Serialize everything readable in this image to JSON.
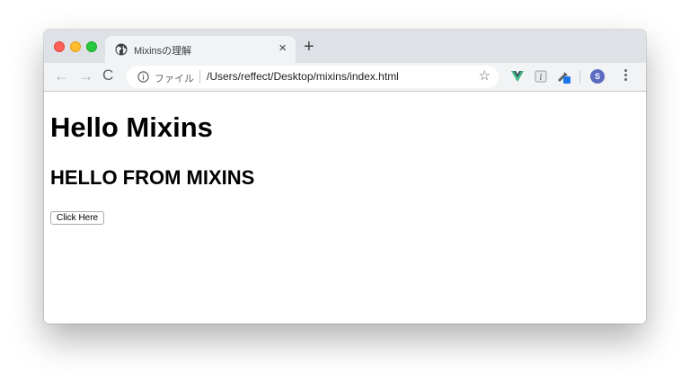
{
  "browser": {
    "tab": {
      "title": "Mixinsの理解",
      "close_glyph": "×"
    },
    "new_tab_glyph": "+",
    "nav": {
      "back_glyph": "←",
      "forward_glyph": "→",
      "reload_glyph": "C"
    },
    "omnibox": {
      "scheme_label": "ファイル",
      "url": "/Users/reffect/Desktop/mixins/index.html",
      "star_glyph": "☆"
    },
    "avatar_initial": "S"
  },
  "page": {
    "heading": "Hello Mixins",
    "subheading": "HELLO FROM MIXINS",
    "button_label": "Click Here"
  }
}
